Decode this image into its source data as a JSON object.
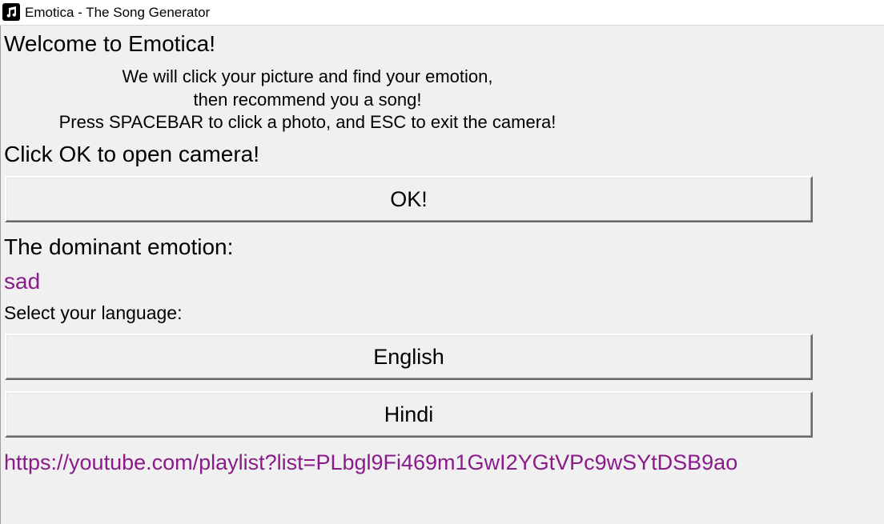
{
  "window": {
    "title": "Emotica - The Song Generator",
    "icon": "music-note-icon"
  },
  "welcome": "Welcome to Emotica!",
  "intro": {
    "line1": "We will click your picture and find your emotion,",
    "line2": "then recommend you a song!",
    "line3": "Press SPACEBAR to click a photo, and ESC to exit the camera!"
  },
  "camera_prompt": "Click OK to open camera!",
  "ok_button": "OK!",
  "dominant_label": "The dominant emotion:",
  "dominant_value": "sad",
  "language_label": "Select your language:",
  "language_buttons": {
    "english": "English",
    "hindi": "Hindi"
  },
  "playlist_link": "https://youtube.com/playlist?list=PLbgl9Fi469m1GwI2YGtVPc9wSYtDSB9ao",
  "colors": {
    "accent_text": "#8b1a8b",
    "background": "#f0f0f0"
  }
}
